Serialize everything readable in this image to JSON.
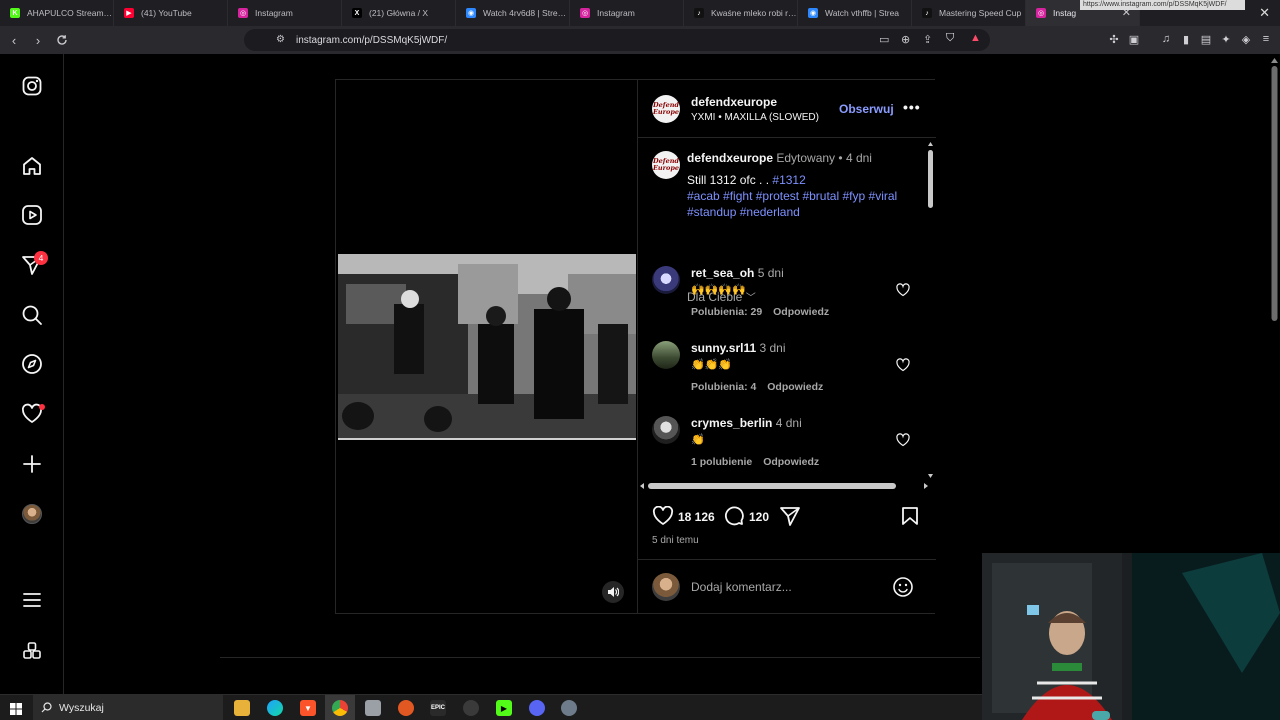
{
  "browser": {
    "tabs": [
      {
        "label": "AHAPULCO Stream - V",
        "fav_color": "#53fc18",
        "fav_char": "K"
      },
      {
        "label": "(41) YouTube",
        "fav_color": "#ff0033",
        "fav_char": "▶"
      },
      {
        "label": "Instagram",
        "fav_color": "#d6249f",
        "fav_char": "◎"
      },
      {
        "label": "(21) Główna / X",
        "fav_color": "#000000",
        "fav_char": "X"
      },
      {
        "label": "Watch 4rv6d8 | Stream",
        "fav_color": "#2d88ff",
        "fav_char": "◉"
      },
      {
        "label": "Instagram",
        "fav_color": "#d6249f",
        "fav_char": "◎"
      },
      {
        "label": "Kwaśne mleko robi rob",
        "fav_color": "#111111",
        "fav_char": "♪"
      },
      {
        "label": "Watch vthffb | Strea",
        "fav_color": "#2d88ff",
        "fav_char": "◉"
      },
      {
        "label": "Mastering Speed Cup",
        "fav_color": "#111111",
        "fav_char": "♪"
      },
      {
        "label": "Instag",
        "fav_color": "#d6249f",
        "fav_char": "◎"
      }
    ],
    "url": "instagram.com/p/DSSMqK5jWDF/",
    "hover_url": "https://www.instagram.com/p/DSSMqK5jWDF/"
  },
  "sidebar": {
    "notifications_badge": "4"
  },
  "post": {
    "author": "defendxeurope",
    "avatar_text": "Defend Europe",
    "audio": "YXMI • MAXILLA (SLOWED)",
    "follow_label": "Obserwuj",
    "more_label": "•••",
    "caption": {
      "user": "defendxeurope",
      "edited": "Edytowany",
      "sep": "•",
      "age": "4 dni",
      "text": "Still 1312 ofc . .",
      "tags_line1": [
        "#1312"
      ],
      "tags_line2": [
        "#acab",
        "#fight",
        "#protest",
        "#brutal",
        "#fyp",
        "#viral"
      ],
      "tags_line3": [
        "#standup",
        "#nederland"
      ]
    },
    "filter_label": "Dla Ciebie",
    "comments": [
      {
        "user": "ret_sea_oh",
        "age": "5 dni",
        "body": "🙌🙌🙌🙌",
        "likes": "Polubienia: 29",
        "reply": "Odpowiedz"
      },
      {
        "user": "sunny.srl11",
        "age": "3 dni",
        "body": "👏👏👏",
        "likes": "Polubienia: 4",
        "reply": "Odpowiedz"
      },
      {
        "user": "crymes_berlin",
        "age": "4 dni",
        "body": "👏",
        "likes": "1 polubienie",
        "reply": "Odpowiedz"
      }
    ],
    "like_count": "18 126",
    "comment_count": "120",
    "date": "5 dni temu",
    "add_comment_placeholder": "Dodaj komentarz..."
  },
  "taskbar": {
    "search_label": "Wyszukaj"
  }
}
